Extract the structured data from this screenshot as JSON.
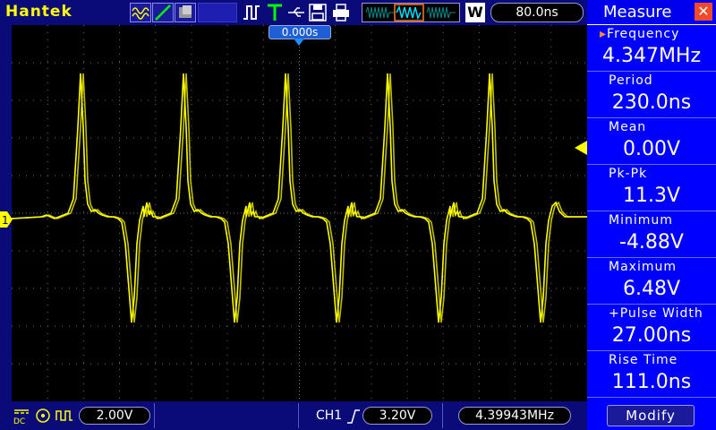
{
  "app": {
    "brand": "Hantek"
  },
  "toolbar": {
    "icons": [
      "acquire-wave-icon",
      "slope-icon",
      "persistence-icon",
      "run-icon",
      "trigger-icon",
      "usb-icon",
      "save-icon",
      "printer-icon"
    ],
    "timebase_mode": "W",
    "timebase": "80.0ns"
  },
  "screen": {
    "trigger_position": "0.000s",
    "channel_marker": "1",
    "trace_color": "#ffff00",
    "grid_color": "#6e6e6e"
  },
  "bottom": {
    "ch_coupling": "DC",
    "ch_scale": "2.00V",
    "trigger_source": "CH1",
    "trigger_level": "3.20V",
    "frequency_counter": "4.39943MHz"
  },
  "measure": {
    "title": "Measure",
    "items": [
      {
        "label": "Frequency",
        "value": "4.347MHz"
      },
      {
        "label": "Period",
        "value": "230.0ns"
      },
      {
        "label": "Mean",
        "value": "0.00V"
      },
      {
        "label": "Pk-Pk",
        "value": "11.3V"
      },
      {
        "label": "Minimum",
        "value": "-4.88V"
      },
      {
        "label": "Maximum",
        "value": "6.48V"
      },
      {
        "label": "+Pulse Width",
        "value": "27.00ns"
      },
      {
        "label": "Rise Time",
        "value": "111.0ns"
      }
    ],
    "modify_label": "Modify"
  },
  "colors": {
    "accent": "#ffff00",
    "panel": "#0000ff",
    "bar": "#0a0a78",
    "close": "#f04a2a"
  }
}
